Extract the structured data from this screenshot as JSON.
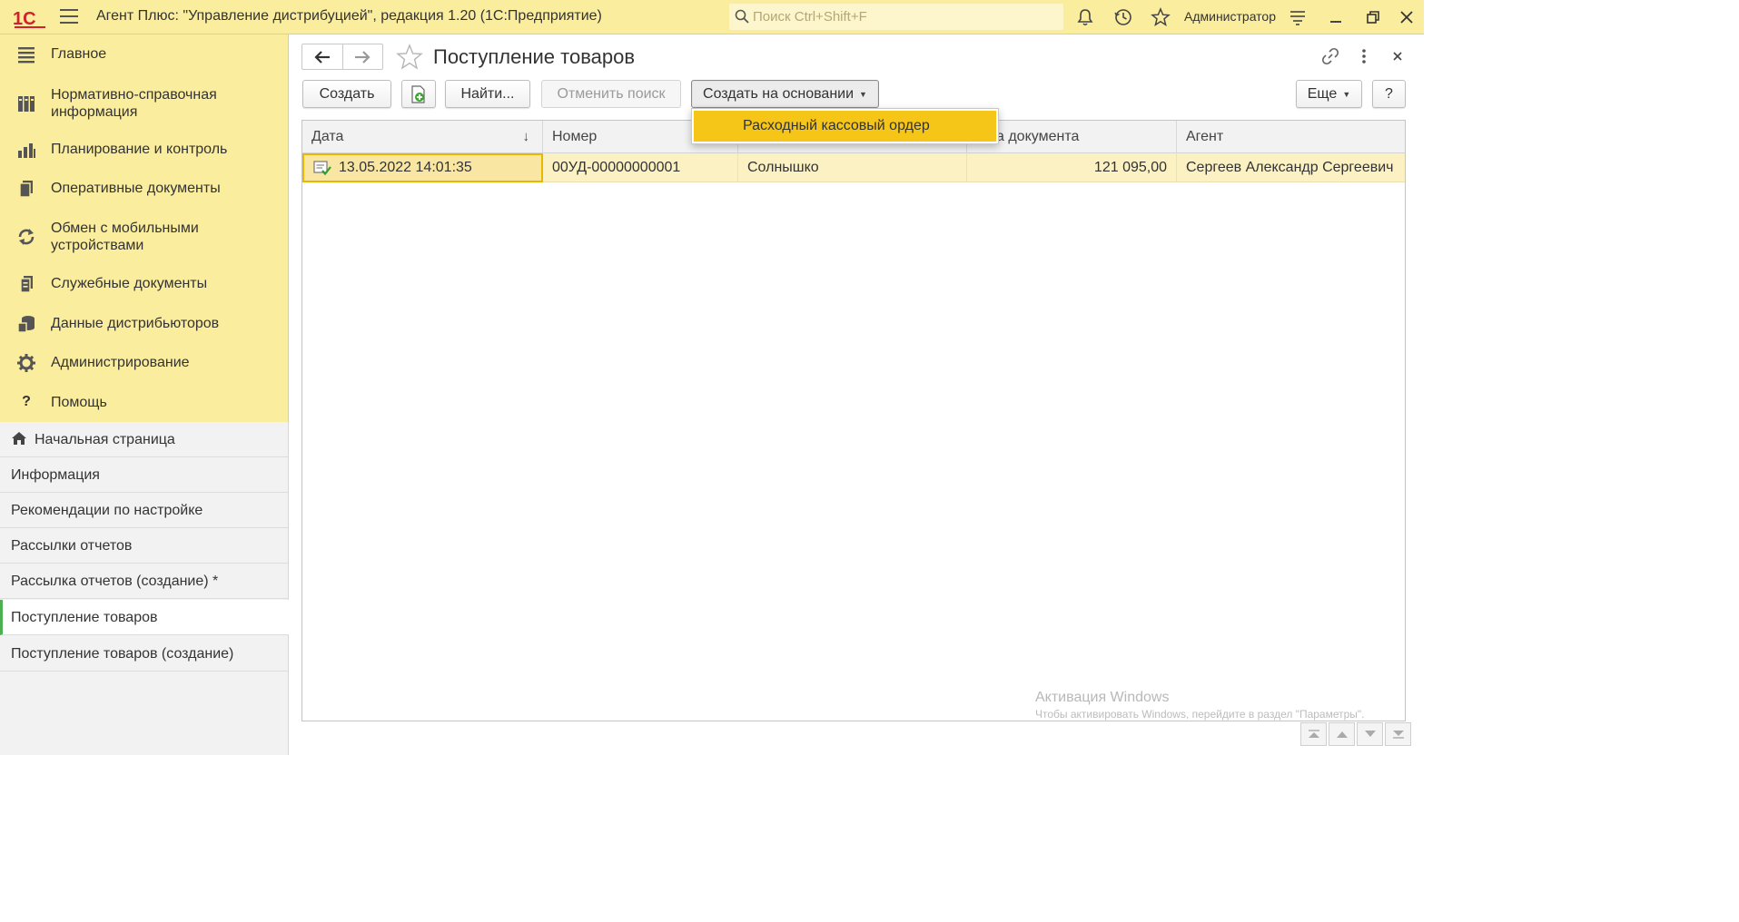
{
  "titlebar": {
    "logo_text": "1С",
    "app_title": "Агент Плюс: \"Управление дистрибуцией\", редакция 1.20  (1С:Предприятие)",
    "search_placeholder": "Поиск Ctrl+Shift+F",
    "user": "Администратор"
  },
  "sections": [
    {
      "label": "Главное",
      "icon": "menu-lines-icon"
    },
    {
      "label": "Нормативно-справочная информация",
      "icon": "reference-book-icon"
    },
    {
      "label": "Планирование и контроль",
      "icon": "bar-chart-icon"
    },
    {
      "label": "Оперативные документы",
      "icon": "documents-icon"
    },
    {
      "label": "Обмен с мобильными устройствами",
      "icon": "sync-icon"
    },
    {
      "label": "Служебные документы",
      "icon": "service-documents-icon"
    },
    {
      "label": "Данные дистрибьюторов",
      "icon": "database-icon"
    },
    {
      "label": "Администрирование",
      "icon": "gear-icon"
    },
    {
      "label": "Помощь",
      "icon": "help-icon"
    }
  ],
  "open_windows": [
    {
      "label": "Начальная страница",
      "icon": "home-icon"
    },
    {
      "label": "Информация"
    },
    {
      "label": "Рекомендации по настройке"
    },
    {
      "label": "Рассылки отчетов"
    },
    {
      "label": "Рассылка отчетов (создание) *"
    },
    {
      "label": "Поступление товаров",
      "active": true
    },
    {
      "label": "Поступление товаров (создание)"
    }
  ],
  "page": {
    "title": "Поступление товаров"
  },
  "toolbar": {
    "create": "Создать",
    "find": "Найти...",
    "cancel_search": "Отменить поиск",
    "create_based_on": "Создать на основании",
    "more": "Еще",
    "help": "?"
  },
  "dropdown": {
    "items": [
      "Расходный кассовый ордер"
    ]
  },
  "table": {
    "columns": [
      "Дата",
      "Номер",
      "",
      "мма документа",
      "Агент"
    ],
    "sort_indicator": "↓",
    "rows": [
      {
        "date": "13.05.2022 14:01:35",
        "number": "00УД-00000000001",
        "counterparty": "Солнышко",
        "amount": "121 095,00",
        "agent": "Сергеев Александр Сергеевич"
      }
    ]
  },
  "watermark": {
    "line1": "Активация Windows",
    "line2": "Чтобы активировать Windows, перейдите в раздел \"Параметры\"."
  },
  "colors": {
    "panel_yellow": "#fbed9e",
    "accent_yellow": "#f5c518",
    "row_highlight": "#fbf1c3",
    "active_marker": "#4caf50"
  }
}
